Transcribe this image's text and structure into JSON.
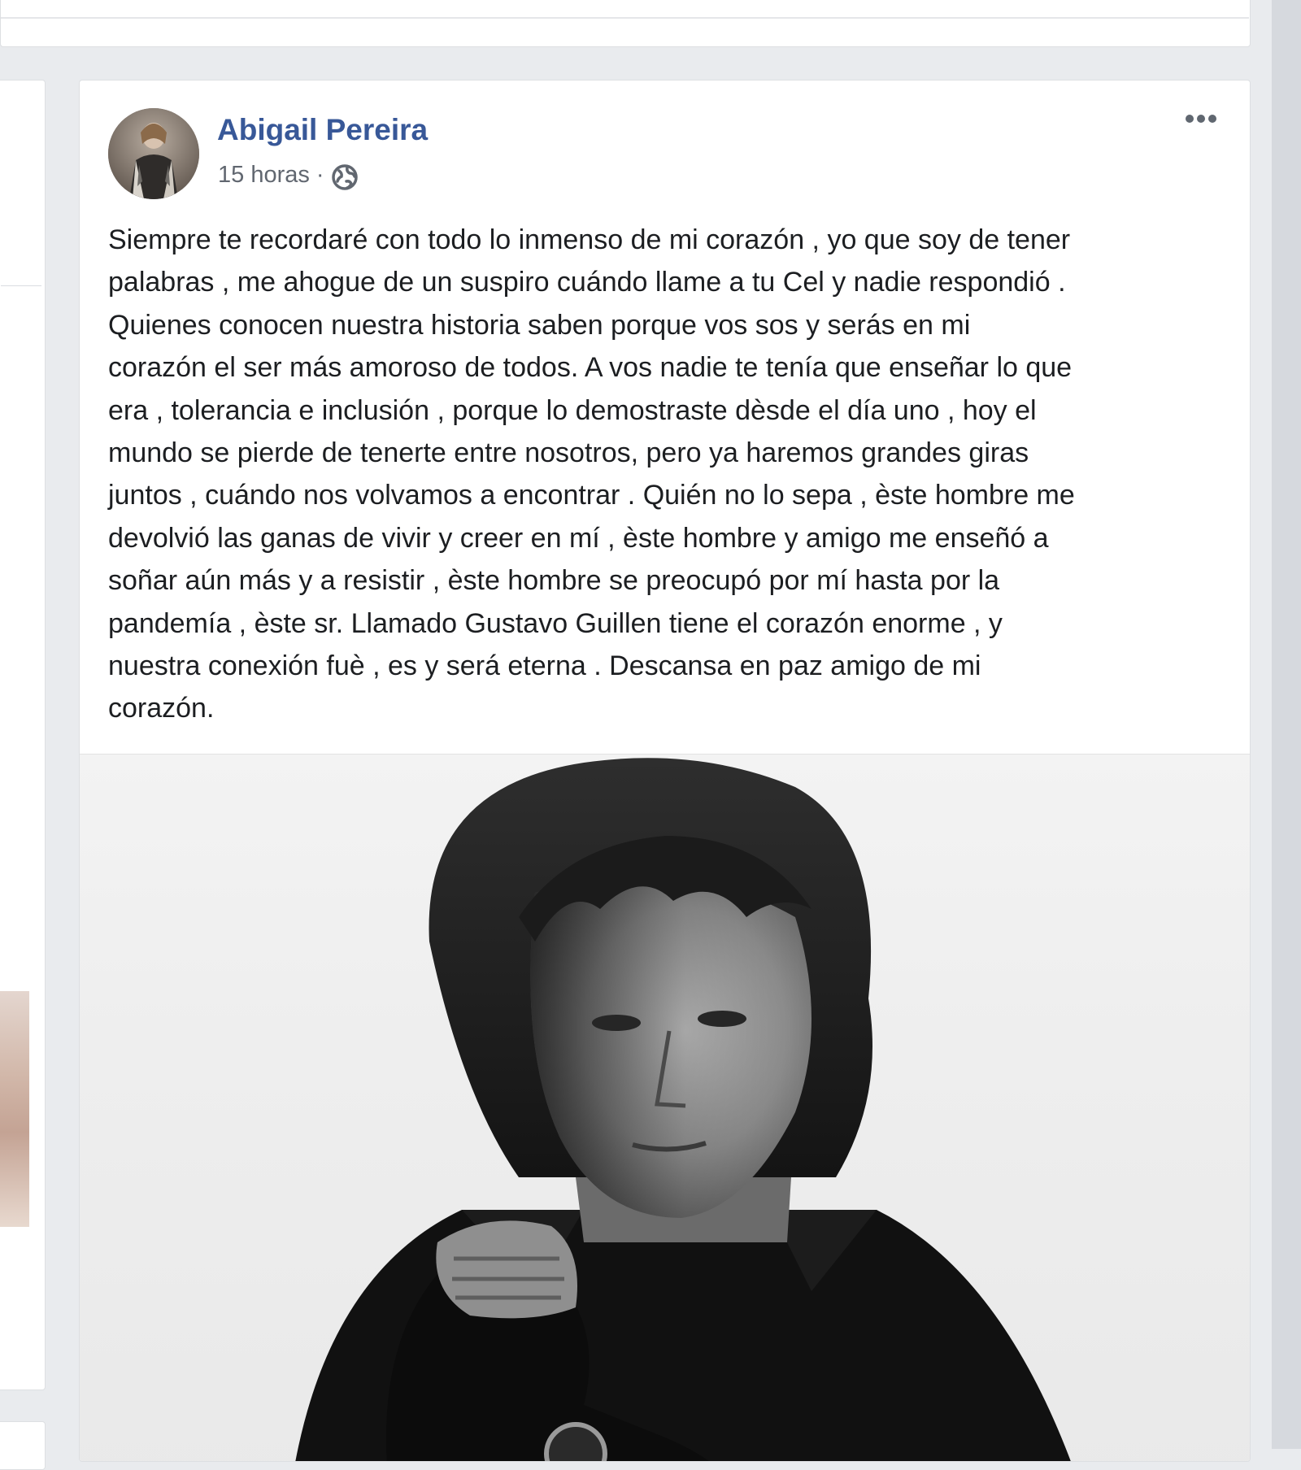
{
  "post": {
    "author_name": "Abigail Pereira",
    "time_label": "15 horas",
    "separator": "·",
    "visibility_icon": "globe-icon",
    "more_icon": "more-options-icon",
    "text_lines": [
      "Siempre te recordaré con todo lo inmenso de mi corazón , yo que soy de tener",
      "palabras , me ahogue de un suspiro cuándo llame a tu Cel y nadie respondió .",
      "Quienes conocen nuestra historia saben porque vos sos y serás en mi",
      "corazón el ser más amoroso de todos. A vos nadie te tenía que enseñar lo que",
      "era , tolerancia e inclusión , porque lo demostraste dèsde el día uno , hoy el",
      "mundo se pierde de tenerte entre nosotros, pero ya haremos grandes giras",
      "juntos , cuándo nos volvamos a encontrar . Quién no lo sepa , èste hombre me",
      "devolvió las ganas de vivir y creer en mí , èste hombre y amigo me enseñó a",
      "soñar aún más y a resistir , èste hombre se preocupó por mí hasta por la",
      "pandemía , èste sr. Llamado Gustavo Guillen tiene el corazón enorme , y",
      "nuestra conexión fuè , es y será eterna . Descansa en paz amigo de mi",
      "corazón."
    ]
  },
  "colors": {
    "page_background": "#e9ebee",
    "card_background": "#ffffff",
    "author_link": "#385898",
    "meta_text": "#616770",
    "body_text": "#1c1e21"
  }
}
